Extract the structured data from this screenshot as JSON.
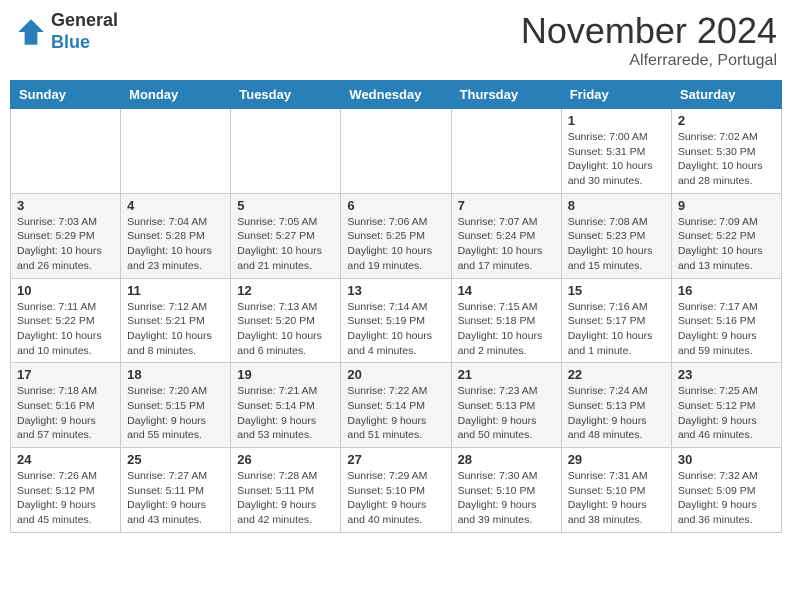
{
  "logo": {
    "general": "General",
    "blue": "Blue"
  },
  "header": {
    "month": "November 2024",
    "location": "Alferrarede, Portugal"
  },
  "weekdays": [
    "Sunday",
    "Monday",
    "Tuesday",
    "Wednesday",
    "Thursday",
    "Friday",
    "Saturday"
  ],
  "weeks": [
    [
      {
        "day": "",
        "info": ""
      },
      {
        "day": "",
        "info": ""
      },
      {
        "day": "",
        "info": ""
      },
      {
        "day": "",
        "info": ""
      },
      {
        "day": "",
        "info": ""
      },
      {
        "day": "1",
        "info": "Sunrise: 7:00 AM\nSunset: 5:31 PM\nDaylight: 10 hours\nand 30 minutes."
      },
      {
        "day": "2",
        "info": "Sunrise: 7:02 AM\nSunset: 5:30 PM\nDaylight: 10 hours\nand 28 minutes."
      }
    ],
    [
      {
        "day": "3",
        "info": "Sunrise: 7:03 AM\nSunset: 5:29 PM\nDaylight: 10 hours\nand 26 minutes."
      },
      {
        "day": "4",
        "info": "Sunrise: 7:04 AM\nSunset: 5:28 PM\nDaylight: 10 hours\nand 23 minutes."
      },
      {
        "day": "5",
        "info": "Sunrise: 7:05 AM\nSunset: 5:27 PM\nDaylight: 10 hours\nand 21 minutes."
      },
      {
        "day": "6",
        "info": "Sunrise: 7:06 AM\nSunset: 5:25 PM\nDaylight: 10 hours\nand 19 minutes."
      },
      {
        "day": "7",
        "info": "Sunrise: 7:07 AM\nSunset: 5:24 PM\nDaylight: 10 hours\nand 17 minutes."
      },
      {
        "day": "8",
        "info": "Sunrise: 7:08 AM\nSunset: 5:23 PM\nDaylight: 10 hours\nand 15 minutes."
      },
      {
        "day": "9",
        "info": "Sunrise: 7:09 AM\nSunset: 5:22 PM\nDaylight: 10 hours\nand 13 minutes."
      }
    ],
    [
      {
        "day": "10",
        "info": "Sunrise: 7:11 AM\nSunset: 5:22 PM\nDaylight: 10 hours\nand 10 minutes."
      },
      {
        "day": "11",
        "info": "Sunrise: 7:12 AM\nSunset: 5:21 PM\nDaylight: 10 hours\nand 8 minutes."
      },
      {
        "day": "12",
        "info": "Sunrise: 7:13 AM\nSunset: 5:20 PM\nDaylight: 10 hours\nand 6 minutes."
      },
      {
        "day": "13",
        "info": "Sunrise: 7:14 AM\nSunset: 5:19 PM\nDaylight: 10 hours\nand 4 minutes."
      },
      {
        "day": "14",
        "info": "Sunrise: 7:15 AM\nSunset: 5:18 PM\nDaylight: 10 hours\nand 2 minutes."
      },
      {
        "day": "15",
        "info": "Sunrise: 7:16 AM\nSunset: 5:17 PM\nDaylight: 10 hours\nand 1 minute."
      },
      {
        "day": "16",
        "info": "Sunrise: 7:17 AM\nSunset: 5:16 PM\nDaylight: 9 hours\nand 59 minutes."
      }
    ],
    [
      {
        "day": "17",
        "info": "Sunrise: 7:18 AM\nSunset: 5:16 PM\nDaylight: 9 hours\nand 57 minutes."
      },
      {
        "day": "18",
        "info": "Sunrise: 7:20 AM\nSunset: 5:15 PM\nDaylight: 9 hours\nand 55 minutes."
      },
      {
        "day": "19",
        "info": "Sunrise: 7:21 AM\nSunset: 5:14 PM\nDaylight: 9 hours\nand 53 minutes."
      },
      {
        "day": "20",
        "info": "Sunrise: 7:22 AM\nSunset: 5:14 PM\nDaylight: 9 hours\nand 51 minutes."
      },
      {
        "day": "21",
        "info": "Sunrise: 7:23 AM\nSunset: 5:13 PM\nDaylight: 9 hours\nand 50 minutes."
      },
      {
        "day": "22",
        "info": "Sunrise: 7:24 AM\nSunset: 5:13 PM\nDaylight: 9 hours\nand 48 minutes."
      },
      {
        "day": "23",
        "info": "Sunrise: 7:25 AM\nSunset: 5:12 PM\nDaylight: 9 hours\nand 46 minutes."
      }
    ],
    [
      {
        "day": "24",
        "info": "Sunrise: 7:26 AM\nSunset: 5:12 PM\nDaylight: 9 hours\nand 45 minutes."
      },
      {
        "day": "25",
        "info": "Sunrise: 7:27 AM\nSunset: 5:11 PM\nDaylight: 9 hours\nand 43 minutes."
      },
      {
        "day": "26",
        "info": "Sunrise: 7:28 AM\nSunset: 5:11 PM\nDaylight: 9 hours\nand 42 minutes."
      },
      {
        "day": "27",
        "info": "Sunrise: 7:29 AM\nSunset: 5:10 PM\nDaylight: 9 hours\nand 40 minutes."
      },
      {
        "day": "28",
        "info": "Sunrise: 7:30 AM\nSunset: 5:10 PM\nDaylight: 9 hours\nand 39 minutes."
      },
      {
        "day": "29",
        "info": "Sunrise: 7:31 AM\nSunset: 5:10 PM\nDaylight: 9 hours\nand 38 minutes."
      },
      {
        "day": "30",
        "info": "Sunrise: 7:32 AM\nSunset: 5:09 PM\nDaylight: 9 hours\nand 36 minutes."
      }
    ]
  ]
}
